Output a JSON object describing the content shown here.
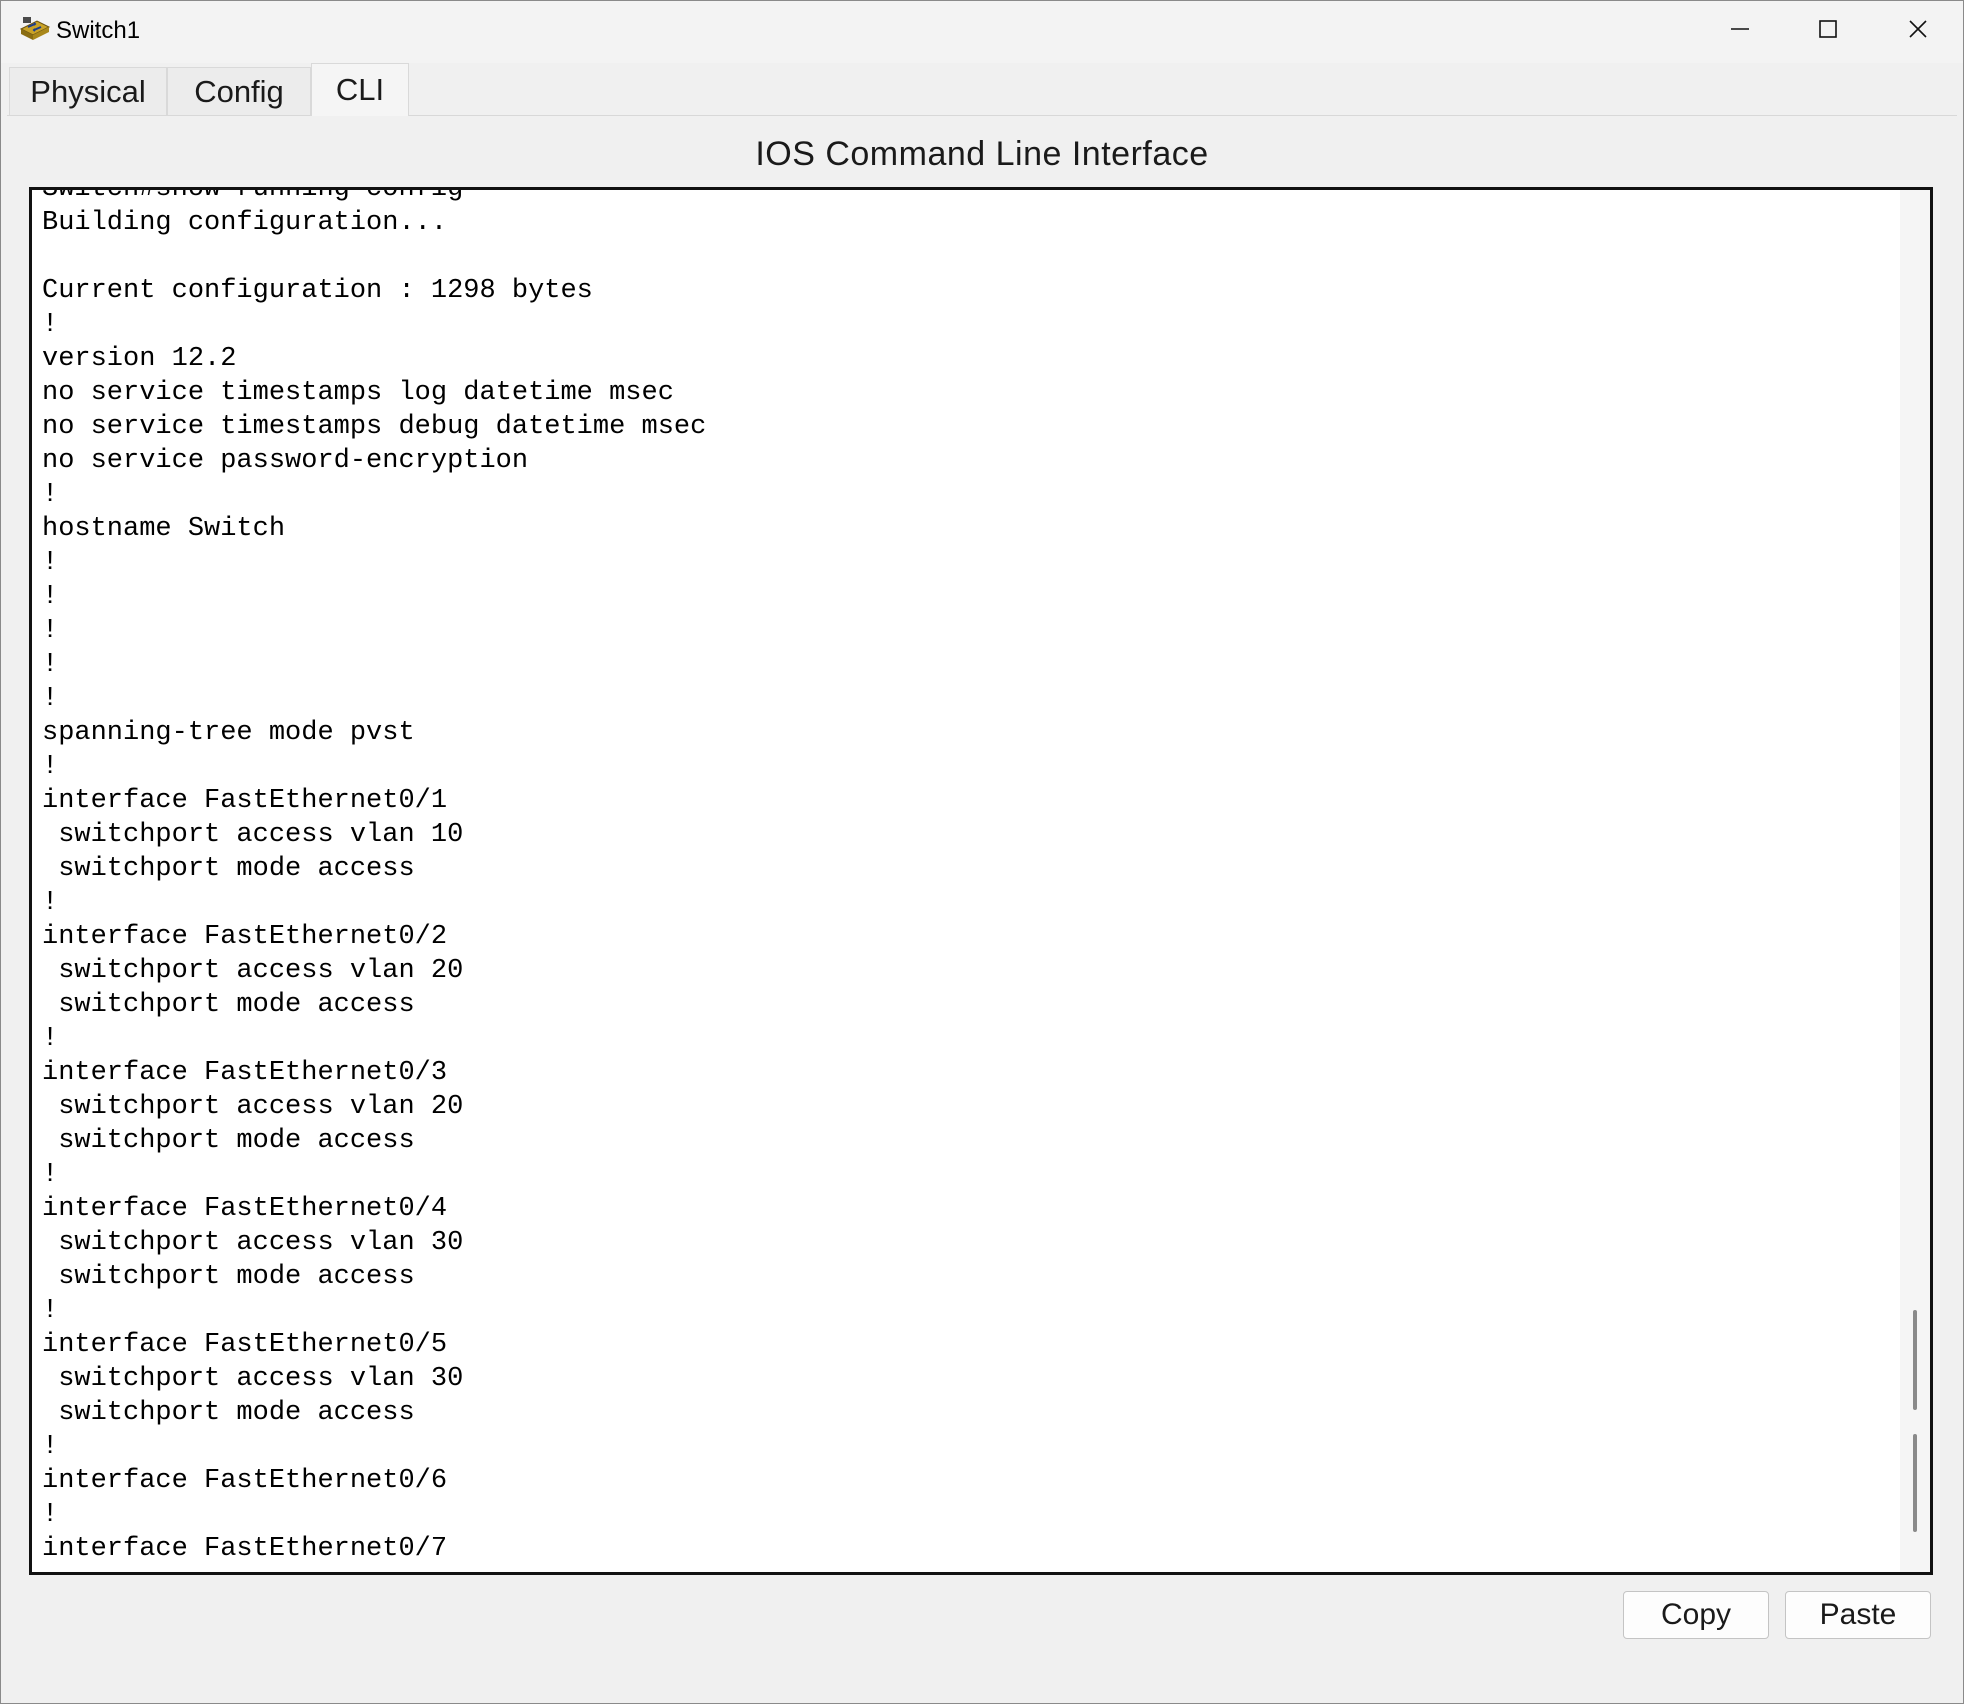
{
  "window": {
    "title": "Switch1",
    "icon": "switch-device-icon",
    "controls": [
      "minimize-icon",
      "maximize-icon",
      "close-icon"
    ]
  },
  "tabs": [
    {
      "label": "Physical",
      "active": false
    },
    {
      "label": "Config",
      "active": false
    },
    {
      "label": "CLI",
      "active": true
    }
  ],
  "panel": {
    "title": "IOS Command Line Interface"
  },
  "terminal": {
    "text": "Switch#show running-config\nBuilding configuration...\n\nCurrent configuration : 1298 bytes\n!\nversion 12.2\nno service timestamps log datetime msec\nno service timestamps debug datetime msec\nno service password-encryption\n!\nhostname Switch\n!\n!\n!\n!\n!\nspanning-tree mode pvst\n!\ninterface FastEthernet0/1\n switchport access vlan 10\n switchport mode access\n!\ninterface FastEthernet0/2\n switchport access vlan 20\n switchport mode access\n!\ninterface FastEthernet0/3\n switchport access vlan 20\n switchport mode access\n!\ninterface FastEthernet0/4\n switchport access vlan 30\n switchport mode access\n!\ninterface FastEthernet0/5\n switchport access vlan 30\n switchport mode access\n!\ninterface FastEthernet0/6\n!\ninterface FastEthernet0/7"
  },
  "buttons": {
    "copy": "Copy",
    "paste": "Paste"
  }
}
